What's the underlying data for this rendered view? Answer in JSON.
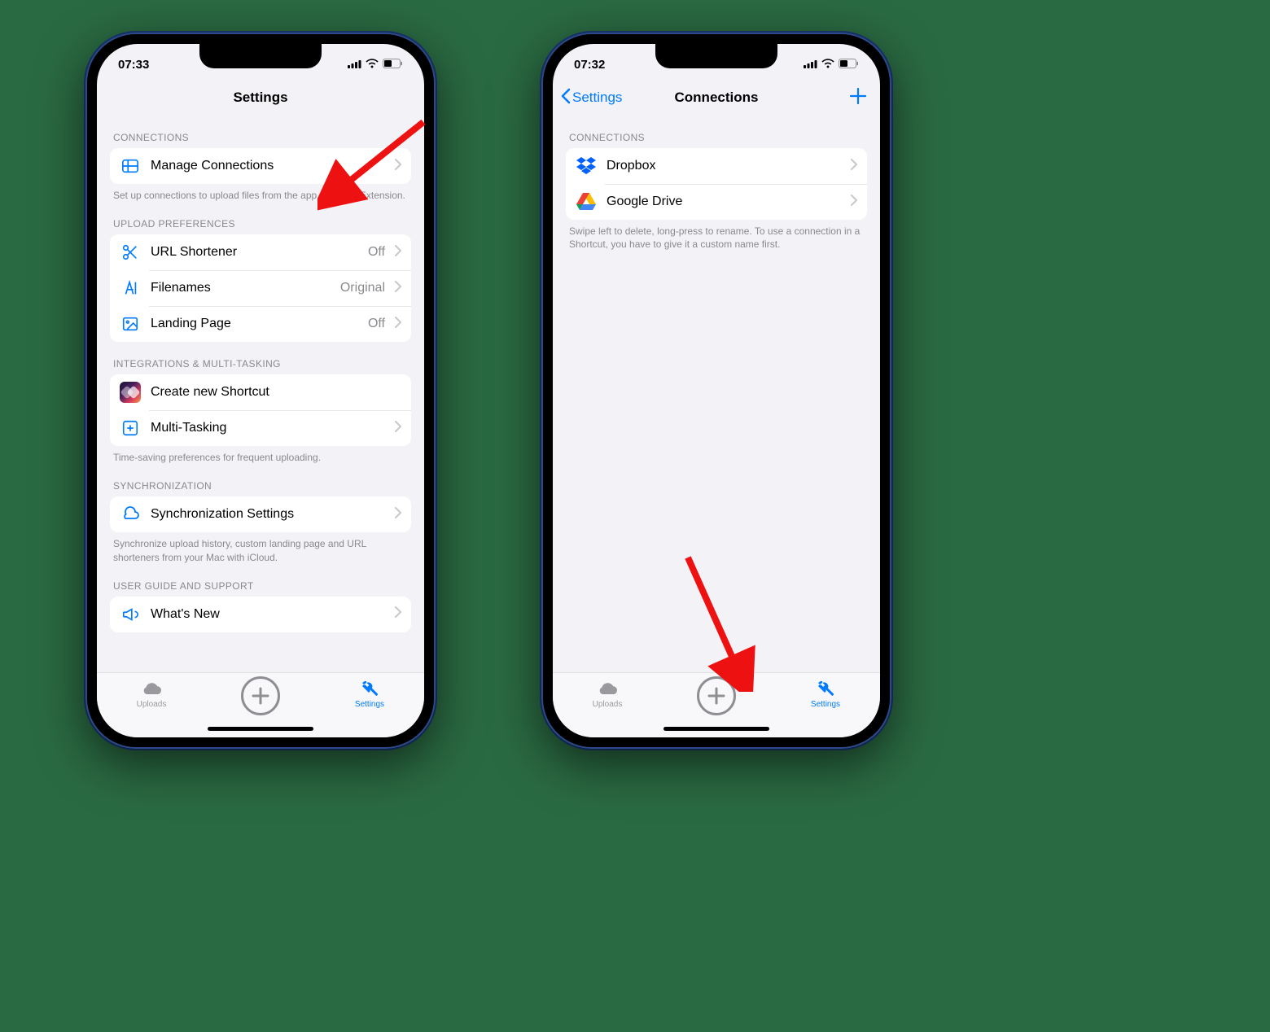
{
  "colors": {
    "tint": "#007aff"
  },
  "left": {
    "status": {
      "time": "07:33"
    },
    "nav": {
      "title": "Settings"
    },
    "sections": {
      "connections": {
        "header": "CONNECTIONS",
        "manage_label": "Manage Connections",
        "footer": "Set up connections to upload files from the app or Share Extension."
      },
      "upload_prefs": {
        "header": "UPLOAD PREFERENCES",
        "url_shortener": {
          "label": "URL Shortener",
          "value": "Off"
        },
        "filenames": {
          "label": "Filenames",
          "value": "Original"
        },
        "landing_page": {
          "label": "Landing Page",
          "value": "Off"
        }
      },
      "integrations": {
        "header": "INTEGRATIONS & MULTI-TASKING",
        "create_shortcut": "Create new Shortcut",
        "multitasking": "Multi-Tasking",
        "footer": "Time-saving preferences for frequent uploading."
      },
      "sync": {
        "header": "SYNCHRONIZATION",
        "settings_label": "Synchronization Settings",
        "footer": "Synchronize upload history, custom landing page and URL shorteners from your Mac with iCloud."
      },
      "guide": {
        "header": "USER GUIDE AND SUPPORT",
        "whats_new": "What's New"
      }
    },
    "tabs": {
      "uploads": "Uploads",
      "settings": "Settings"
    }
  },
  "right": {
    "status": {
      "time": "07:32"
    },
    "nav": {
      "back": "Settings",
      "title": "Connections"
    },
    "sections": {
      "connections": {
        "header": "CONNECTIONS",
        "items": [
          {
            "label": "Dropbox"
          },
          {
            "label": "Google Drive"
          }
        ],
        "footer": "Swipe left to delete, long-press to rename. To use a connection in a Shortcut, you have to give it a custom name first."
      }
    },
    "tabs": {
      "uploads": "Uploads",
      "settings": "Settings"
    }
  }
}
